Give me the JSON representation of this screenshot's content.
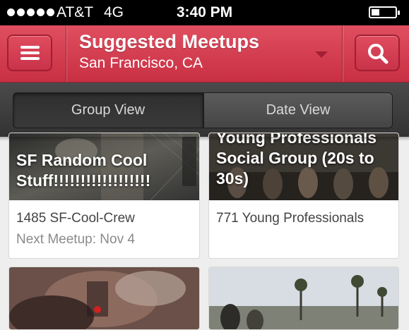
{
  "status_bar": {
    "carrier": "AT&T",
    "network": "4G",
    "time": "3:40 PM",
    "signal_bars": 5,
    "battery_level": 0.25
  },
  "header": {
    "title": "Suggested Meetups",
    "location": "San Francisco, CA",
    "menu_icon": "hamburger-menu-icon",
    "search_icon": "search-icon",
    "accent_color": "#d4394c"
  },
  "view_toggle": {
    "group_view_label": "Group View",
    "date_view_label": "Date View",
    "selected": "Group View"
  },
  "groups": [
    {
      "name": "SF Random Cool Stuff!!!!!!!!!!!!!!!!!!",
      "member_count_text": "1485 SF-Cool-Crew",
      "next_meetup": "Next Meetup: Nov 4"
    },
    {
      "name": "Young Professionals Social Group (20s to 30s)",
      "member_count_text": "771 Young Professionals",
      "next_meetup": ""
    }
  ]
}
